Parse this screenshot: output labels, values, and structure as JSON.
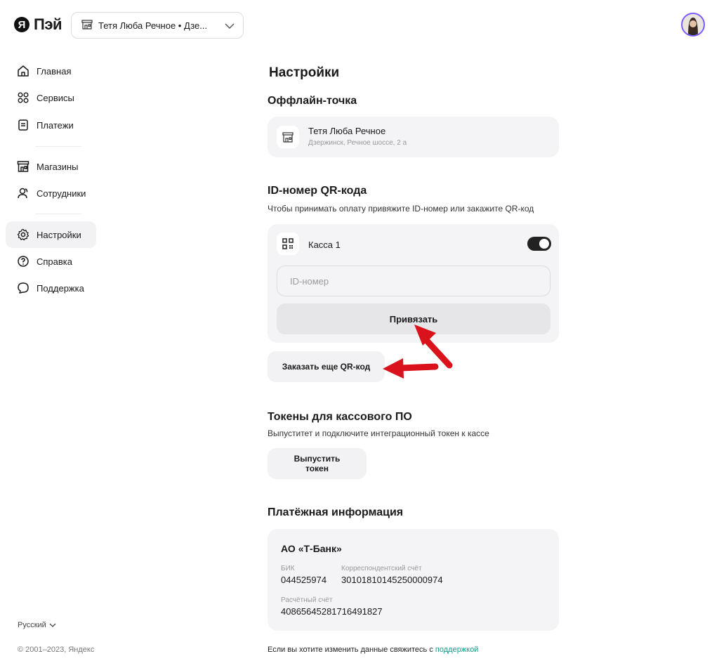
{
  "header": {
    "logo_letter": "Я",
    "logo_text": "Пэй",
    "shop_selector": "Тетя Люба Речное • Дзе..."
  },
  "sidebar": {
    "items": [
      {
        "label": "Главная",
        "icon": "home-icon"
      },
      {
        "label": "Сервисы",
        "icon": "grid-icon"
      },
      {
        "label": "Платежи",
        "icon": "receipt-icon"
      },
      {
        "label": "Магазины",
        "icon": "store-icon"
      },
      {
        "label": "Сотрудники",
        "icon": "users-icon"
      },
      {
        "label": "Настройки",
        "icon": "gear-icon",
        "active": true
      },
      {
        "label": "Справка",
        "icon": "help-icon"
      },
      {
        "label": "Поддержка",
        "icon": "chat-icon"
      }
    ],
    "language": "Русский",
    "copyright": "© 2001–2023, Яндекс"
  },
  "main": {
    "title": "Настройки",
    "offline": {
      "title": "Оффлайн-точка",
      "store_name": "Тетя Люба Речное",
      "store_address": "Дзержинск, Речное шоссе, 2 а"
    },
    "qr": {
      "title": "ID-номер QR-кода",
      "subtitle": "Чтобы принимать оплату привяжите ID-номер или закажите QR-код",
      "kassa_label": "Касса 1",
      "toggle_on": true,
      "id_placeholder": "ID-номер",
      "bind_button": "Привязать",
      "order_button": "Заказать еще QR-код"
    },
    "tokens": {
      "title": "Токены для кассового ПО",
      "subtitle": "Выпуститет и подключите интеграционный токен к кассе",
      "issue_button": "Выпустить токен"
    },
    "payment": {
      "title": "Платёжная информация",
      "bank_name": "АО «Т-Банк»",
      "bik_label": "БИК",
      "bik_value": "044525974",
      "corr_label": "Корреспондентский счёт",
      "corr_value": "30101810145250000974",
      "account_label": "Расчётный счёт",
      "account_value": "40865645281716491827"
    },
    "footer_note": "Если вы хотите изменить данные свяжитесь с ",
    "footer_link": "поддержкой"
  },
  "colors": {
    "annotation_arrow": "#d9121b",
    "link": "#1a9c8a",
    "avatar_ring": "#7b5cff"
  }
}
